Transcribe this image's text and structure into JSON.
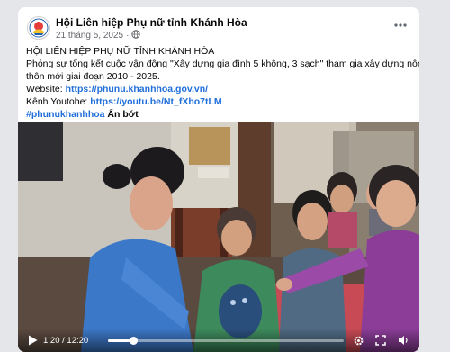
{
  "post": {
    "page_name": "Hội Liên hiệp Phụ nữ tỉnh Khánh Hòa",
    "date": "21 tháng 5, 2025",
    "date_separator": "·",
    "privacy_icon": "globe-icon",
    "more_icon": "more-dots-icon",
    "lines": {
      "heading": "HỘI LIÊN HIỆP PHỤ NỮ TỈNH KHÁNH HÒA",
      "body_line1": "Phóng sự tổng kết cuộc vận động \"Xây dựng gia đình 5 không, 3 sạch\" tham gia xây dựng nông",
      "body_line2": "thôn mới giai đoạn 2010 - 2025.",
      "website_label": "Website: ",
      "website_url": "https://phunu.khanhhoa.gov.vn/",
      "youtube_label": "Kênh Youtobe: ",
      "youtube_url": "https://youtu.be/Nt_fXho7tLM",
      "hashtag": "#phunukhanhhoa",
      "see_less": "Ẩn bớt"
    }
  },
  "video": {
    "current_time": "1:20",
    "time_separator": " / ",
    "duration": "12:20",
    "progress_fraction": 0.108,
    "icons": [
      "play-icon",
      "settings-icon",
      "fullscreen-icon",
      "volume-icon"
    ]
  },
  "colors": {
    "page_bg": "#e4e6ea",
    "card_bg": "#ffffff",
    "link": "#216fdb",
    "text": "#050505",
    "muted": "#65676b"
  }
}
